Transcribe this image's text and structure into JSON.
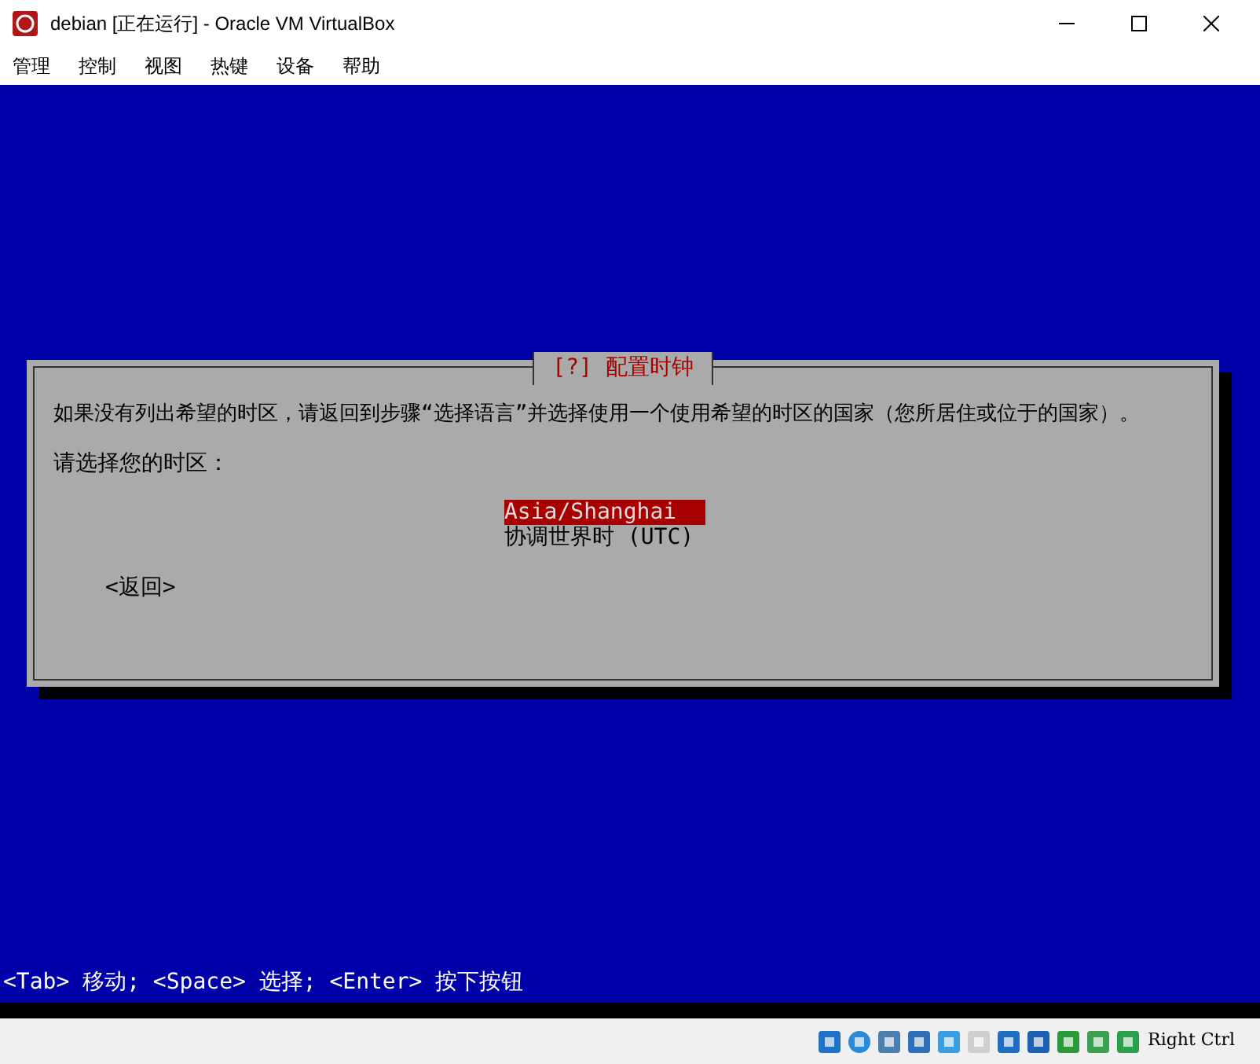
{
  "window": {
    "title": "debian [正在运行] - Oracle VM VirtualBox"
  },
  "menu": [
    "管理",
    "控制",
    "视图",
    "热键",
    "设备",
    "帮助"
  ],
  "dialog": {
    "title": "[?] 配置时钟",
    "message": "如果没有列出希望的时区，请返回到步骤“选择语言”并选择使用一个使用希望的时区的国家（您所居住或位于的国家）。",
    "prompt": "请选择您的时区：",
    "options": [
      {
        "label": "Asia/Shanghai",
        "selected": true
      },
      {
        "label": "协调世界时 (UTC)",
        "selected": false
      }
    ],
    "back_button": "<返回>"
  },
  "hint_bar": "<Tab> 移动; <Space> 选择; <Enter> 按下按钮",
  "status_bar": {
    "host_key": "Right Ctrl"
  }
}
